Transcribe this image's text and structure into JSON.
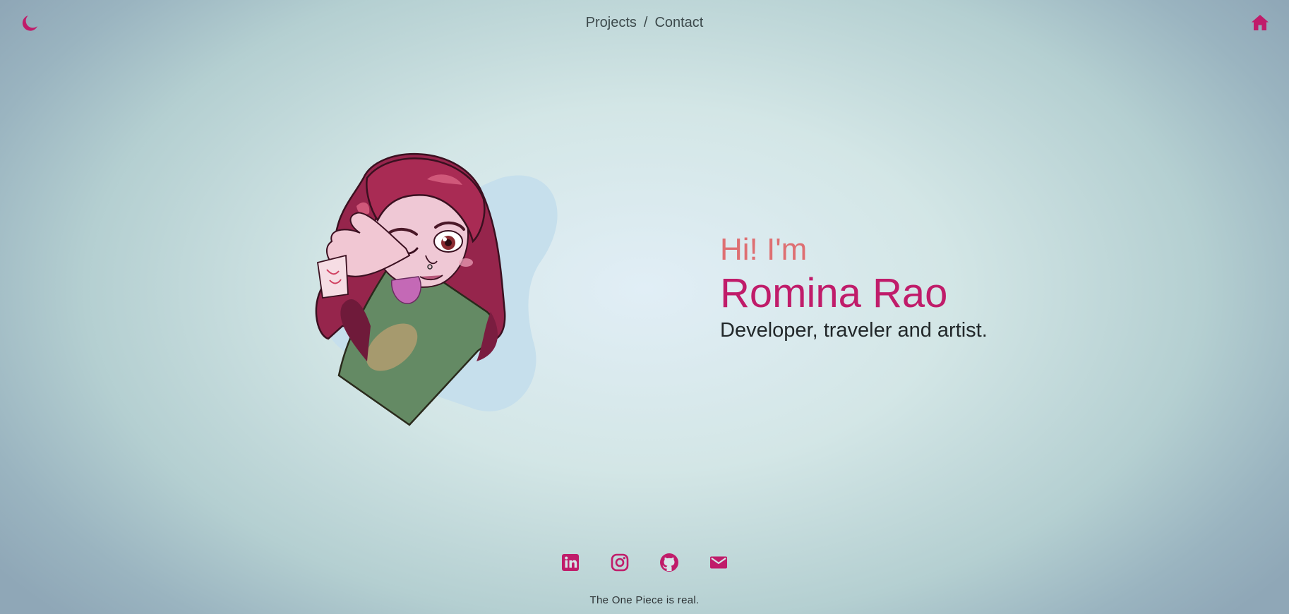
{
  "header": {
    "nav": [
      {
        "label": "Projects"
      },
      {
        "label": "Contact"
      }
    ],
    "separator": "/",
    "theme_icon": "moon-icon",
    "home_icon": "home-icon"
  },
  "hero": {
    "greeting": "Hi! I'm",
    "name": "Romina Rao",
    "tagline": "Developer, traveler and artist."
  },
  "avatar": {
    "description_icon": "avatar-illustration"
  },
  "socials": [
    {
      "icon": "linkedin-icon"
    },
    {
      "icon": "instagram-icon"
    },
    {
      "icon": "github-icon"
    },
    {
      "icon": "mail-icon"
    }
  ],
  "footer": {
    "text": "The One Piece is real."
  },
  "colors": {
    "accent": "#c01c6a",
    "greeting": "#de6f72",
    "text": "#22282a",
    "nav_text": "#3d4a4c"
  }
}
